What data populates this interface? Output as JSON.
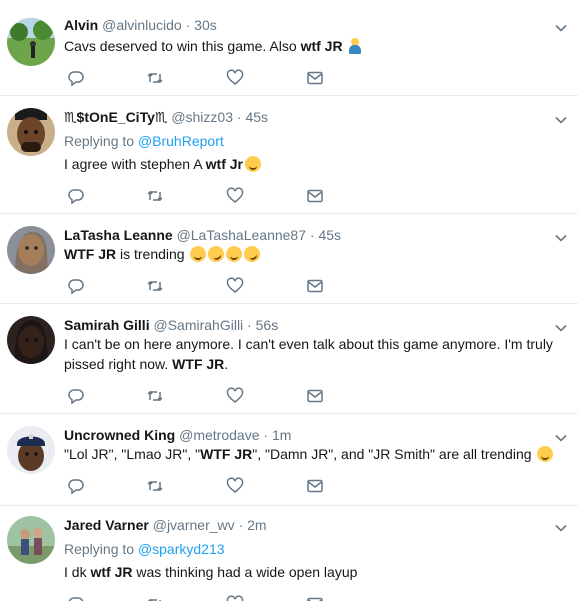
{
  "tweets": [
    {
      "name": "Alvin",
      "handle": "@alvinlucido",
      "time": "30s",
      "replying_prefix": "",
      "replying_to": "",
      "text_pre": "Cavs deserved to win this game. Also ",
      "text_bold": "wtf JR",
      "text_post": " ",
      "emoji": [
        "person-shrugging"
      ]
    },
    {
      "name": "♏$tOnE_CiTy♏",
      "handle": "@shizz03",
      "time": "45s",
      "replying_prefix": "Replying to ",
      "replying_to": "@BruhReport",
      "text_pre": "I agree with stephen A ",
      "text_bold": "wtf Jr",
      "text_post": "",
      "emoji": [
        "flushed-face"
      ]
    },
    {
      "name": "LaTasha Leanne",
      "handle": "@LaTashaLeanne87",
      "time": "45s",
      "replying_prefix": "",
      "replying_to": "",
      "text_pre": "",
      "text_bold": "WTF JR",
      "text_post": " is trending ",
      "emoji": [
        "joy",
        "rofl",
        "joy",
        "rofl"
      ]
    },
    {
      "name": "Samirah Gilli",
      "handle": "@SamirahGilli",
      "time": "56s",
      "replying_prefix": "",
      "replying_to": "",
      "text_pre": "I can't be on here anymore. I can't even talk about this game anymore. I'm truly pissed right now. ",
      "text_bold": "WTF JR",
      "text_post": ".",
      "emoji": []
    },
    {
      "name": "Uncrowned King",
      "handle": "@metrodave",
      "time": "1m",
      "replying_prefix": "",
      "replying_to": "",
      "text_pre": "\"Lol JR\", \"Lmao JR\", \"",
      "text_bold": "WTF JR",
      "text_post": "\", \"Damn JR\", and \"JR Smith\" are all trending ",
      "emoji": [
        "joy"
      ]
    },
    {
      "name": "Jared Varner",
      "handle": "@jvarner_wv",
      "time": "2m",
      "replying_prefix": "Replying to ",
      "replying_to": "@sparkyd213",
      "text_pre": "I dk ",
      "text_bold": "wtf JR",
      "text_post": " was thinking had a wide open layup",
      "emoji": []
    }
  ],
  "separator": " · ",
  "icons": {
    "reply": "reply-icon",
    "retweet": "retweet-icon",
    "like": "heart-icon",
    "message": "envelope-icon",
    "menu": "chevron-down-icon"
  },
  "colors": {
    "text": "#14171a",
    "secondary": "#657786",
    "link": "#1da1f2",
    "border": "#e6ecf0",
    "icon": "#657786"
  }
}
